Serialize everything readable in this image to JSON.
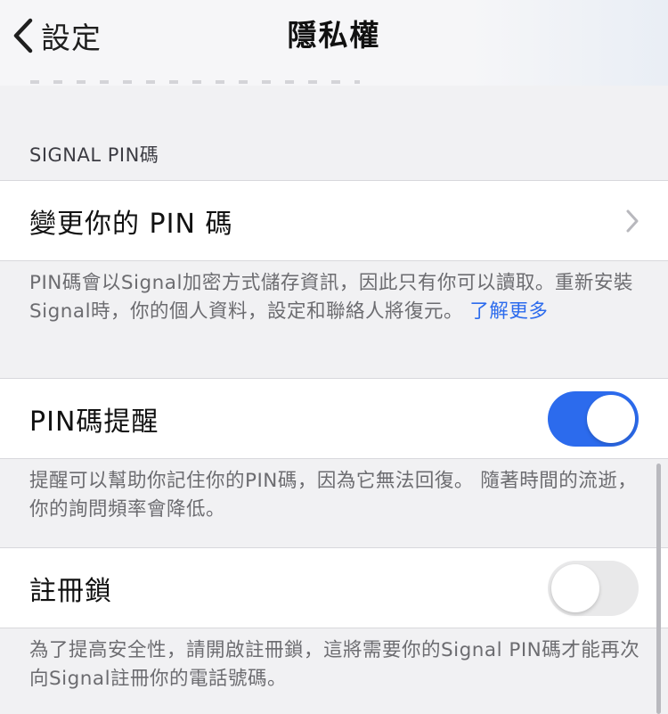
{
  "navbar": {
    "back_label": "設定",
    "title": "隱私權"
  },
  "section": {
    "header": "SIGNAL PIN碼"
  },
  "change_pin": {
    "label": "變更你的 PIN 碼"
  },
  "pin_footer": {
    "text": "PIN碼會以Signal加密方式儲存資訊，因此只有你可以讀取。重新安裝Signal時，你的個人資料，設定和聯絡人將復元。 ",
    "link_text": "了解更多"
  },
  "pin_reminders": {
    "label": "PIN碼提醒",
    "enabled": true,
    "footer": "提醒可以幫助你記住你的PIN碼，因為它無法回復。 隨著時間的流逝，你的詢問頻率會降低。"
  },
  "registration_lock": {
    "label": "註冊鎖",
    "enabled": false,
    "footer": "為了提高安全性，請開啟註冊鎖，這將需要你的Signal PIN碼才能再次向Signal註冊你的電話號碼。"
  },
  "colors": {
    "accent": "#2c6bed",
    "background": "#f1f1f3",
    "footer_text": "#6c6c70"
  },
  "icons": {
    "back": "chevron-left-icon",
    "disclosure": "chevron-right-icon"
  }
}
